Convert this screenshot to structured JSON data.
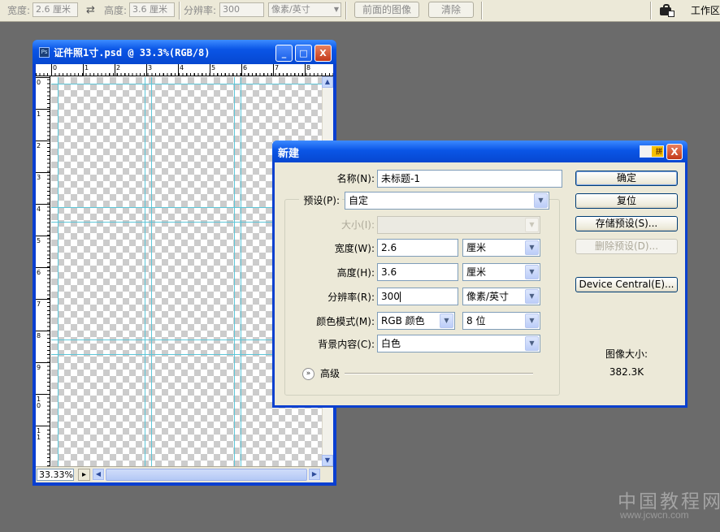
{
  "options_bar": {
    "width_label": "宽度:",
    "width_value": "2.6 厘米",
    "swap_icon": "swap-arrows-icon",
    "height_label": "高度:",
    "height_value": "3.6 厘米",
    "resolution_label": "分辨率:",
    "resolution_value": "300",
    "resolution_unit": "像素/英寸",
    "front_image_button": "前面的图像",
    "clear_button": "清除",
    "workspace_label": "工作区",
    "workspace_icon": "workspace-icon"
  },
  "document": {
    "title": "证件照1寸.psd @ 33.3%(RGB/8)",
    "app_icon_text": "Ps",
    "minimize": "_",
    "maximize": "□",
    "close": "X",
    "ruler_top": [
      "0",
      "1",
      "2",
      "3",
      "4",
      "5",
      "6",
      "7",
      "8"
    ],
    "ruler_left": [
      "0",
      "1",
      "2",
      "3",
      "4",
      "5",
      "6",
      "7",
      "8",
      "9",
      "1\n0",
      "1\n1"
    ],
    "zoom": "33.33%",
    "status_menu": "▸",
    "scroll_up": "▲",
    "scroll_down": "▼",
    "scroll_left": "◀",
    "scroll_right": "▶"
  },
  "dialog": {
    "title": "新建",
    "close": "X",
    "name_label": "名称(N):",
    "name_value": "未标题-1",
    "preset_label": "预设(P):",
    "preset_value": "自定",
    "size_label": "大小(I):",
    "size_value": "",
    "width_label": "宽度(W):",
    "width_value": "2.6",
    "width_unit": "厘米",
    "height_label": "高度(H):",
    "height_value": "3.6",
    "height_unit": "厘米",
    "resolution_label": "分辨率(R):",
    "resolution_value": "300",
    "resolution_unit": "像素/英寸",
    "color_mode_label": "颜色模式(M):",
    "color_mode_value": "RGB 颜色",
    "bit_depth_value": "8 位",
    "background_label": "背景内容(C):",
    "background_value": "白色",
    "advanced_label": "高级",
    "buttons": {
      "ok": "确定",
      "reset": "复位",
      "save_preset": "存储预设(S)...",
      "delete_preset": "删除预设(D)...",
      "device_central": "Device Central(E)..."
    },
    "image_size_label": "图像大小:",
    "image_size_value": "382.3K"
  },
  "watermark": {
    "line1": "中国教程网",
    "line2": "www.jcwcn.com"
  },
  "colors": {
    "xp_title_blue": "#0a55e6",
    "workspace_gray": "#6b6b6b",
    "dialog_face": "#ece9d8",
    "guide_cyan": "#5ec6d8"
  }
}
